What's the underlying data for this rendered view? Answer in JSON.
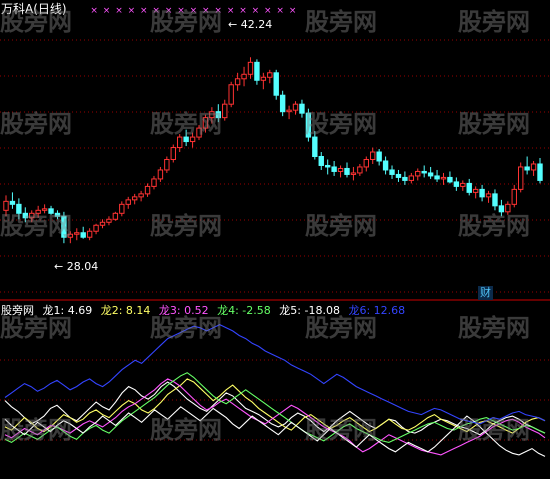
{
  "header": {
    "title": "万科A(日线)",
    "markers": "× × × × × × × × × × × × × × × × ×"
  },
  "callouts": {
    "high": "42.24",
    "low": "28.04",
    "cai": "财"
  },
  "indicators": [
    {
      "label": "股旁网",
      "color": "#ffffff"
    },
    {
      "label": "龙1: 4.69",
      "color": "#ffffff"
    },
    {
      "label": "龙2: 8.14",
      "color": "#ffff66"
    },
    {
      "label": "龙3: 0.52",
      "color": "#ff55ff"
    },
    {
      "label": "龙4: -2.58",
      "color": "#66ff66"
    },
    {
      "label": "龙5: -18.08",
      "color": "#ffffff"
    },
    {
      "label": "龙6: 12.68",
      "color": "#3344ff"
    }
  ],
  "watermark": "股旁网",
  "colors": {
    "up": "#ff3333",
    "down": "#54ffff",
    "grid": "#990000",
    "long1": "#ffffff",
    "long2": "#ffff66",
    "long3": "#ff55ff",
    "long4": "#66ff66",
    "long5": "#ffffff",
    "long6": "#3344ff"
  },
  "chart_data": [
    {
      "type": "candlestick",
      "y_range": [
        26,
        45
      ],
      "candles": [
        [
          32.0,
          33.0,
          31.6,
          32.6
        ],
        [
          32.6,
          33.2,
          32.1,
          32.4
        ],
        [
          32.4,
          32.8,
          31.4,
          31.8
        ],
        [
          31.8,
          32.2,
          31.2,
          31.5
        ],
        [
          31.5,
          32.0,
          31.2,
          31.8
        ],
        [
          31.8,
          32.3,
          31.5,
          32.0
        ],
        [
          32.0,
          32.4,
          31.8,
          32.1
        ],
        [
          32.1,
          32.3,
          31.7,
          31.8
        ],
        [
          31.8,
          32.0,
          31.4,
          31.6
        ],
        [
          31.6,
          31.9,
          29.8,
          30.2
        ],
        [
          30.2,
          30.6,
          29.8,
          30.4
        ],
        [
          30.4,
          30.8,
          30.0,
          30.5
        ],
        [
          30.5,
          30.9,
          30.1,
          30.2
        ],
        [
          30.2,
          30.8,
          30.0,
          30.6
        ],
        [
          30.6,
          31.1,
          30.4,
          31.0
        ],
        [
          31.0,
          31.4,
          30.8,
          31.2
        ],
        [
          31.2,
          31.6,
          31.0,
          31.4
        ],
        [
          31.4,
          31.9,
          31.3,
          31.8
        ],
        [
          31.8,
          32.6,
          31.6,
          32.4
        ],
        [
          32.4,
          32.9,
          32.1,
          32.7
        ],
        [
          32.7,
          33.1,
          32.4,
          32.9
        ],
        [
          32.9,
          33.3,
          32.6,
          33.1
        ],
        [
          33.1,
          33.8,
          32.9,
          33.6
        ],
        [
          33.6,
          34.3,
          33.4,
          34.1
        ],
        [
          34.1,
          34.9,
          33.9,
          34.7
        ],
        [
          34.7,
          35.6,
          34.5,
          35.4
        ],
        [
          35.4,
          36.4,
          35.2,
          36.2
        ],
        [
          36.2,
          37.1,
          35.9,
          36.9
        ],
        [
          36.9,
          37.4,
          36.3,
          36.6
        ],
        [
          36.6,
          37.2,
          36.2,
          36.9
        ],
        [
          36.9,
          37.7,
          36.7,
          37.5
        ],
        [
          37.5,
          38.4,
          37.2,
          38.2
        ],
        [
          38.2,
          38.9,
          37.8,
          38.6
        ],
        [
          38.6,
          39.1,
          37.9,
          38.2
        ],
        [
          38.2,
          39.4,
          38.0,
          39.1
        ],
        [
          39.1,
          40.6,
          38.9,
          40.4
        ],
        [
          40.4,
          41.2,
          40.0,
          40.8
        ],
        [
          40.8,
          41.6,
          40.3,
          41.1
        ],
        [
          41.1,
          42.24,
          40.8,
          41.9
        ],
        [
          41.9,
          42.1,
          40.4,
          40.7
        ],
        [
          40.7,
          41.2,
          40.1,
          40.9
        ],
        [
          40.9,
          41.4,
          40.5,
          41.2
        ],
        [
          41.2,
          41.4,
          39.4,
          39.7
        ],
        [
          39.7,
          40.0,
          38.3,
          38.6
        ],
        [
          38.6,
          39.0,
          38.1,
          38.7
        ],
        [
          38.7,
          39.3,
          38.4,
          39.1
        ],
        [
          39.1,
          39.4,
          38.2,
          38.5
        ],
        [
          38.5,
          38.8,
          36.6,
          36.9
        ],
        [
          36.9,
          37.3,
          35.4,
          35.6
        ],
        [
          35.6,
          35.9,
          34.7,
          35.0
        ],
        [
          35.0,
          35.4,
          34.4,
          34.9
        ],
        [
          34.9,
          35.3,
          34.3,
          34.6
        ],
        [
          34.6,
          35.0,
          34.2,
          34.8
        ],
        [
          34.8,
          35.2,
          34.2,
          34.4
        ],
        [
          34.4,
          34.9,
          34.0,
          34.5
        ],
        [
          34.5,
          35.1,
          34.3,
          34.9
        ],
        [
          34.9,
          35.6,
          34.6,
          35.4
        ],
        [
          35.4,
          36.2,
          35.1,
          35.9
        ],
        [
          35.9,
          36.1,
          35.0,
          35.3
        ],
        [
          35.3,
          35.6,
          34.4,
          34.7
        ],
        [
          34.7,
          35.0,
          34.1,
          34.4
        ],
        [
          34.4,
          34.7,
          33.9,
          34.2
        ],
        [
          34.2,
          34.6,
          33.7,
          34.0
        ],
        [
          34.0,
          34.5,
          33.8,
          34.3
        ],
        [
          34.3,
          34.8,
          34.0,
          34.6
        ],
        [
          34.6,
          35.0,
          34.2,
          34.5
        ],
        [
          34.5,
          34.9,
          34.1,
          34.3
        ],
        [
          34.3,
          34.7,
          33.9,
          34.1
        ],
        [
          34.1,
          34.5,
          33.7,
          34.2
        ],
        [
          34.2,
          34.6,
          33.8,
          33.9
        ],
        [
          33.9,
          34.2,
          33.3,
          33.6
        ],
        [
          33.6,
          34.0,
          33.3,
          33.8
        ],
        [
          33.8,
          34.1,
          33.0,
          33.2
        ],
        [
          33.2,
          33.6,
          32.8,
          33.4
        ],
        [
          33.4,
          33.7,
          32.6,
          32.9
        ],
        [
          32.9,
          33.3,
          32.5,
          33.1
        ],
        [
          33.1,
          33.4,
          32.0,
          32.3
        ],
        [
          32.3,
          32.7,
          31.6,
          31.9
        ],
        [
          31.9,
          32.6,
          31.7,
          32.4
        ],
        [
          32.4,
          33.7,
          32.2,
          33.4
        ],
        [
          33.4,
          35.2,
          33.2,
          34.9
        ],
        [
          34.9,
          35.6,
          34.4,
          34.7
        ],
        [
          34.7,
          35.3,
          34.3,
          35.1
        ],
        [
          35.1,
          35.5,
          33.8,
          34.0
        ]
      ]
    },
    {
      "type": "line",
      "y_range": [
        0,
        100
      ],
      "series": [
        {
          "name": "龙1",
          "values": [
            48,
            44,
            41,
            37,
            33,
            35,
            38,
            43,
            45,
            41,
            37,
            35,
            39,
            43,
            47,
            44,
            42,
            47,
            53,
            57,
            55,
            51,
            49,
            52,
            57,
            60,
            57,
            53,
            49,
            46,
            43,
            41,
            45,
            49,
            53,
            51,
            47,
            43,
            41,
            39,
            36,
            33,
            31,
            33,
            37,
            40,
            38,
            35,
            31,
            28,
            31,
            35,
            38,
            41,
            38,
            35,
            32,
            30,
            33,
            36,
            35,
            31,
            28,
            27,
            29,
            32,
            34,
            36,
            35,
            33,
            31,
            30,
            28,
            26,
            29,
            33,
            35,
            37,
            38,
            36,
            33,
            31,
            29,
            27
          ]
        },
        {
          "name": "龙2",
          "values": [
            31,
            29,
            33,
            37,
            34,
            30,
            28,
            31,
            35,
            39,
            37,
            34,
            36,
            40,
            42,
            39,
            37,
            41,
            45,
            48,
            46,
            42,
            40,
            43,
            47,
            52,
            55,
            58,
            62,
            60,
            56,
            52,
            48,
            51,
            55,
            58,
            54,
            50,
            47,
            43,
            40,
            37,
            34,
            31,
            29,
            33,
            37,
            39,
            36,
            33,
            30,
            32,
            35,
            37,
            34,
            31,
            28,
            30,
            33,
            36,
            33,
            30,
            29,
            31,
            34,
            37,
            39,
            36,
            34,
            32,
            30,
            28,
            31,
            34,
            35,
            33,
            31,
            29,
            27,
            30,
            34,
            36,
            37,
            35
          ]
        },
        {
          "name": "龙3",
          "values": [
            26,
            24,
            27,
            30,
            28,
            26,
            29,
            32,
            31,
            29,
            27,
            30,
            33,
            35,
            33,
            31,
            34,
            37,
            41,
            44,
            46,
            49,
            52,
            55,
            59,
            62,
            60,
            57,
            53,
            49,
            45,
            42,
            44,
            47,
            49,
            46,
            43,
            40,
            37,
            35,
            33,
            36,
            39,
            42,
            45,
            43,
            40,
            37,
            34,
            31,
            29,
            27,
            25,
            22,
            18,
            15,
            17,
            20,
            23,
            26,
            24,
            22,
            20,
            18,
            16,
            15,
            14,
            13,
            15,
            17,
            19,
            21,
            23,
            25,
            28,
            31,
            33,
            35,
            36,
            34,
            31,
            29,
            27,
            24
          ]
        },
        {
          "name": "龙4",
          "values": [
            23,
            21,
            24,
            27,
            25,
            23,
            26,
            29,
            31,
            28,
            25,
            23,
            27,
            30,
            32,
            29,
            27,
            31,
            35,
            38,
            41,
            44,
            47,
            50,
            54,
            58,
            61,
            64,
            66,
            63,
            59,
            55,
            51,
            48,
            46,
            49,
            52,
            55,
            52,
            49,
            46,
            43,
            40,
            37,
            34,
            31,
            28,
            26,
            24,
            22,
            25,
            28,
            31,
            33,
            30,
            28,
            26,
            24,
            22,
            21,
            23,
            25,
            27,
            29,
            31,
            33,
            34,
            32,
            30,
            29,
            31,
            33,
            34,
            36,
            37,
            35,
            33,
            31,
            29,
            30,
            32,
            31,
            29,
            27
          ]
        },
        {
          "name": "龙5",
          "values": [
            36,
            32,
            29,
            26,
            30,
            34,
            31,
            28,
            32,
            35,
            33,
            30,
            27,
            31,
            34,
            38,
            35,
            32,
            36,
            40,
            37,
            34,
            38,
            42,
            39,
            36,
            40,
            44,
            41,
            38,
            35,
            39,
            43,
            40,
            37,
            33,
            30,
            34,
            38,
            35,
            32,
            29,
            26,
            30,
            34,
            31,
            28,
            25,
            22,
            26,
            30,
            27,
            24,
            21,
            18,
            22,
            26,
            23,
            20,
            17,
            15,
            18,
            21,
            19,
            17,
            15,
            18,
            22,
            26,
            30,
            34,
            38,
            35,
            31,
            27,
            23,
            19,
            16,
            14,
            13,
            15,
            17,
            14,
            12
          ]
        },
        {
          "name": "龙6",
          "values": [
            50,
            53,
            56,
            59,
            57,
            54,
            56,
            59,
            61,
            58,
            55,
            57,
            60,
            62,
            59,
            57,
            60,
            64,
            68,
            71,
            74,
            72,
            76,
            80,
            84,
            88,
            90,
            92,
            94,
            96,
            95,
            93,
            95,
            97,
            95,
            93,
            90,
            88,
            85,
            83,
            80,
            78,
            76,
            74,
            71,
            69,
            67,
            65,
            62,
            59,
            62,
            65,
            63,
            60,
            57,
            55,
            53,
            51,
            49,
            47,
            45,
            43,
            41,
            40,
            39,
            41,
            43,
            42,
            40,
            38,
            36,
            35,
            34,
            33,
            35,
            37,
            36,
            38,
            40,
            41,
            39,
            38,
            37,
            35
          ]
        }
      ]
    }
  ]
}
